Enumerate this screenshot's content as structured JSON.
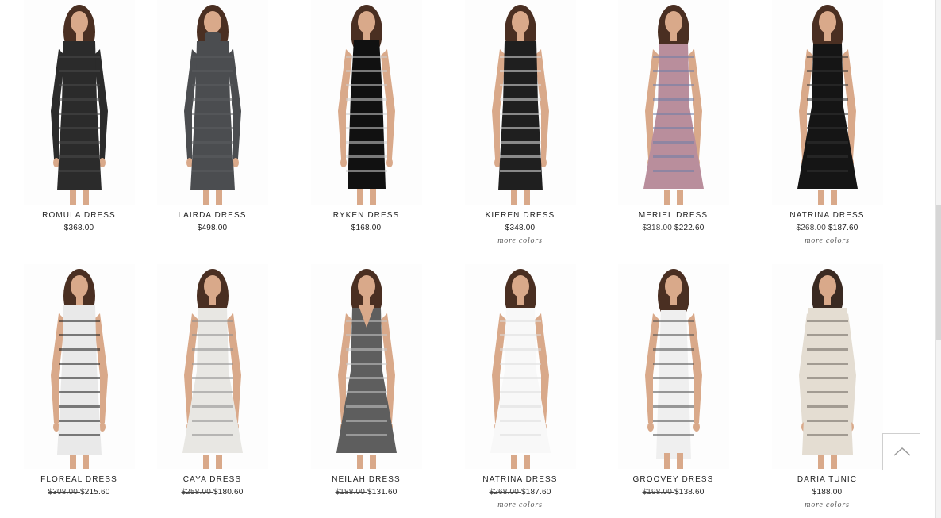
{
  "products": [
    {
      "name": "ROMULA DRESS",
      "price": "$368.00",
      "orig": "",
      "sale": "",
      "more": "",
      "colors": {
        "dress": "#2b2b2b",
        "pattern": "#4a4a4a",
        "hair": "#4a2f22",
        "skin": "#d9a98a"
      },
      "style": "long-sleeve"
    },
    {
      "name": "LAIRDA DRESS",
      "price": "$498.00",
      "orig": "",
      "sale": "",
      "more": "",
      "colors": {
        "dress": "#4b4d50",
        "pattern": "#5c5e61",
        "hair": "#4a2f22",
        "skin": "#d9a98a"
      },
      "style": "turtleneck"
    },
    {
      "name": "RYKEN DRESS",
      "price": "$168.00",
      "orig": "",
      "sale": "",
      "more": "",
      "colors": {
        "dress": "#111111",
        "pattern": "#cfcfcf",
        "hair": "#4a2f22",
        "skin": "#d9a98a"
      },
      "style": "maxi"
    },
    {
      "name": "KIEREN DRESS",
      "price": "$348.00",
      "orig": "",
      "sale": "",
      "more": "more colors",
      "colors": {
        "dress": "#1f1f1f",
        "pattern": "#e0e0e0",
        "hair": "#4a2f22",
        "skin": "#d9a98a"
      },
      "style": "sleeveless"
    },
    {
      "name": "MERIEL DRESS",
      "price": "",
      "orig": "$318.00 ",
      "sale": "$222.60",
      "more": "",
      "colors": {
        "dress": "#b98e9c",
        "pattern": "#6d7ea8",
        "hair": "#4a2f22",
        "skin": "#d9a98a"
      },
      "style": "sleeveless-flare"
    },
    {
      "name": "NATRINA DRESS",
      "price": "",
      "orig": "$268.00 ",
      "sale": "$187.60",
      "more": "more colors",
      "colors": {
        "dress": "#151515",
        "pattern": "#333333",
        "hair": "#4a2f22",
        "skin": "#d9a98a"
      },
      "style": "sleeveless-flare"
    },
    {
      "name": "FLOREAL DRESS",
      "price": "",
      "orig": "$308.00 ",
      "sale": "$215.60",
      "more": "",
      "colors": {
        "dress": "#e9e9e9",
        "pattern": "#1a1a1a",
        "hair": "#4a2f22",
        "skin": "#d9a98a"
      },
      "style": "sleeveless"
    },
    {
      "name": "CAYA DRESS",
      "price": "",
      "orig": "$258.00 ",
      "sale": "$180.60",
      "more": "",
      "colors": {
        "dress": "#e8e7e3",
        "pattern": "#8d8d8d",
        "hair": "#4a2f22",
        "skin": "#d9a98a"
      },
      "style": "sleeveless-flare"
    },
    {
      "name": "NEILAH DRESS",
      "price": "",
      "orig": "$188.00 ",
      "sale": "$131.60",
      "more": "",
      "colors": {
        "dress": "#5e5e5e",
        "pattern": "#c9c9c9",
        "hair": "#4a2f22",
        "skin": "#d9a98a"
      },
      "style": "vneck-flare"
    },
    {
      "name": "NATRINA DRESS",
      "price": "",
      "orig": "$268.00 ",
      "sale": "$187.60",
      "more": "more colors",
      "colors": {
        "dress": "#f8f8f8",
        "pattern": "#dcdcdc",
        "hair": "#4a2f22",
        "skin": "#d9a98a"
      },
      "style": "sleeveless-flare"
    },
    {
      "name": "GROOVEY DRESS",
      "price": "",
      "orig": "$198.00 ",
      "sale": "$138.60",
      "more": "",
      "colors": {
        "dress": "#efefef",
        "pattern": "#4d4d4d",
        "hair": "#4a2f22",
        "skin": "#d9a98a"
      },
      "style": "strapless-maxi"
    },
    {
      "name": "DARIA TUNIC",
      "price": "$188.00",
      "orig": "",
      "sale": "",
      "more": "more colors",
      "colors": {
        "dress": "#e4ddd2",
        "pattern": "#6b655c",
        "hair": "#3a2a22",
        "skin": "#d9a98a"
      },
      "style": "tunic"
    }
  ],
  "back_to_top": {
    "icon": "chevron-up-icon"
  }
}
